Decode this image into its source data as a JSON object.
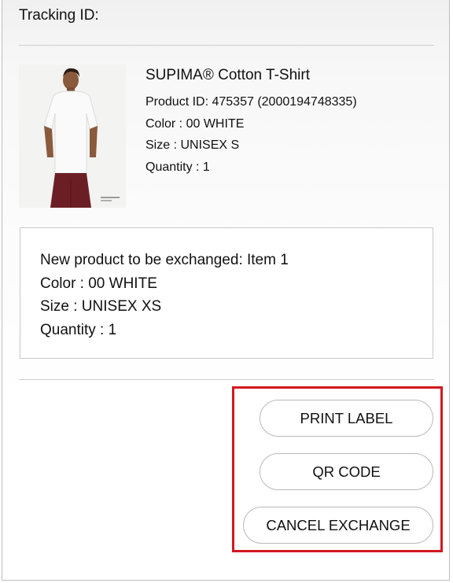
{
  "shipment": {
    "tracking_label": "Tracking ID:"
  },
  "product": {
    "image_icon": "product-photo-man-in-white-tshirt",
    "name": "SUPIMA® Cotton T-Shirt",
    "product_id": "Product ID: 475357 (2000194748335)",
    "color": "Color : 00 WHITE",
    "size": "Size : UNISEX S",
    "quantity": "Quantity : 1"
  },
  "exchange": {
    "heading": "New product to be exchanged: Item 1",
    "color": "Color : 00 WHITE",
    "size": "Size : UNISEX XS",
    "quantity": "Quantity : 1"
  },
  "actions": {
    "print_label": "PRINT LABEL",
    "qr_code": "QR CODE",
    "cancel_exchange": "CANCEL EXCHANGE"
  },
  "colors": {
    "highlight": "#d3171f",
    "button_border": "#b9b9b9"
  }
}
